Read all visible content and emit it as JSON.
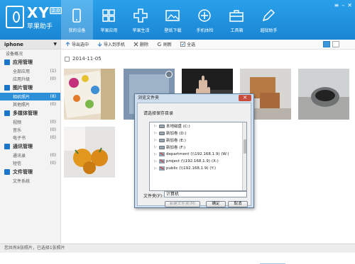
{
  "app": {
    "logo_text": "XY",
    "logo_version": "2.0",
    "logo_subtitle": "苹果助手"
  },
  "nav": [
    {
      "label": "我的设备",
      "icon": "phone-icon",
      "active": true
    },
    {
      "label": "苹果应用",
      "icon": "apps-grid-icon",
      "active": false
    },
    {
      "label": "苹果生活",
      "icon": "plus-cross-icon",
      "active": false
    },
    {
      "label": "壁纸下载",
      "icon": "image-icon",
      "active": false
    },
    {
      "label": "手机体检",
      "icon": "plus-circle-icon",
      "active": false
    },
    {
      "label": "工具箱",
      "icon": "toolbox-icon",
      "active": false
    },
    {
      "label": "越狱助手",
      "icon": "pen-icon",
      "active": false
    }
  ],
  "sidebar": {
    "device_name": "iphone",
    "overview": "设备概况",
    "sections": [
      {
        "title": "应用管理",
        "items": [
          {
            "label": "全部应用",
            "count": "(1)"
          },
          {
            "label": "应用升级",
            "count": "(0)"
          }
        ]
      },
      {
        "title": "图片管理",
        "items": [
          {
            "label": "相机照片",
            "count": "(8)",
            "active": true
          },
          {
            "label": "其他照片",
            "count": "(0)"
          }
        ]
      },
      {
        "title": "多媒体管理",
        "items": [
          {
            "label": "视频",
            "count": "(0)"
          },
          {
            "label": "音乐",
            "count": "(0)"
          },
          {
            "label": "电子书",
            "count": "(0)"
          }
        ]
      },
      {
        "title": "通讯管理",
        "items": [
          {
            "label": "通讯录",
            "count": "(0)"
          },
          {
            "label": "短信",
            "count": "(0)"
          }
        ]
      },
      {
        "title": "文件管理",
        "items": [
          {
            "label": "文件系统",
            "count": ""
          }
        ]
      }
    ]
  },
  "toolbar": {
    "export": "导出选中",
    "import": "导入到手机",
    "delete": "删除",
    "refresh": "刷新",
    "select_all": "全选"
  },
  "content": {
    "date": "2014-11-05"
  },
  "dialog": {
    "title": "浏览文件夹",
    "close": "✕",
    "prompt": "请选择保存目录",
    "tree": [
      {
        "label": "本地磁盘 (C:)",
        "type": "drive"
      },
      {
        "label": "新加卷 (D:)",
        "type": "drive"
      },
      {
        "label": "新加卷 (E:)",
        "type": "drive"
      },
      {
        "label": "新加卷 (F:)",
        "type": "drive"
      },
      {
        "label": "department (\\\\192.168.1.9) (W:)",
        "type": "network"
      },
      {
        "label": "project (\\\\192.168.1.9) (X:)",
        "type": "network"
      },
      {
        "label": "public (\\\\192.168.1.9) (Y:)",
        "type": "network"
      }
    ],
    "folder_label": "文件夹(F):",
    "folder_value": "计算机",
    "new_folder": "新建文件夹(M)",
    "ok": "确定",
    "cancel": "取消"
  },
  "status": {
    "text": "您共有8张照片，已选择1张照片"
  },
  "colors": {
    "header": "#1a86d3",
    "accent": "#2d8fd8",
    "section_icon": "#1a76c9"
  }
}
